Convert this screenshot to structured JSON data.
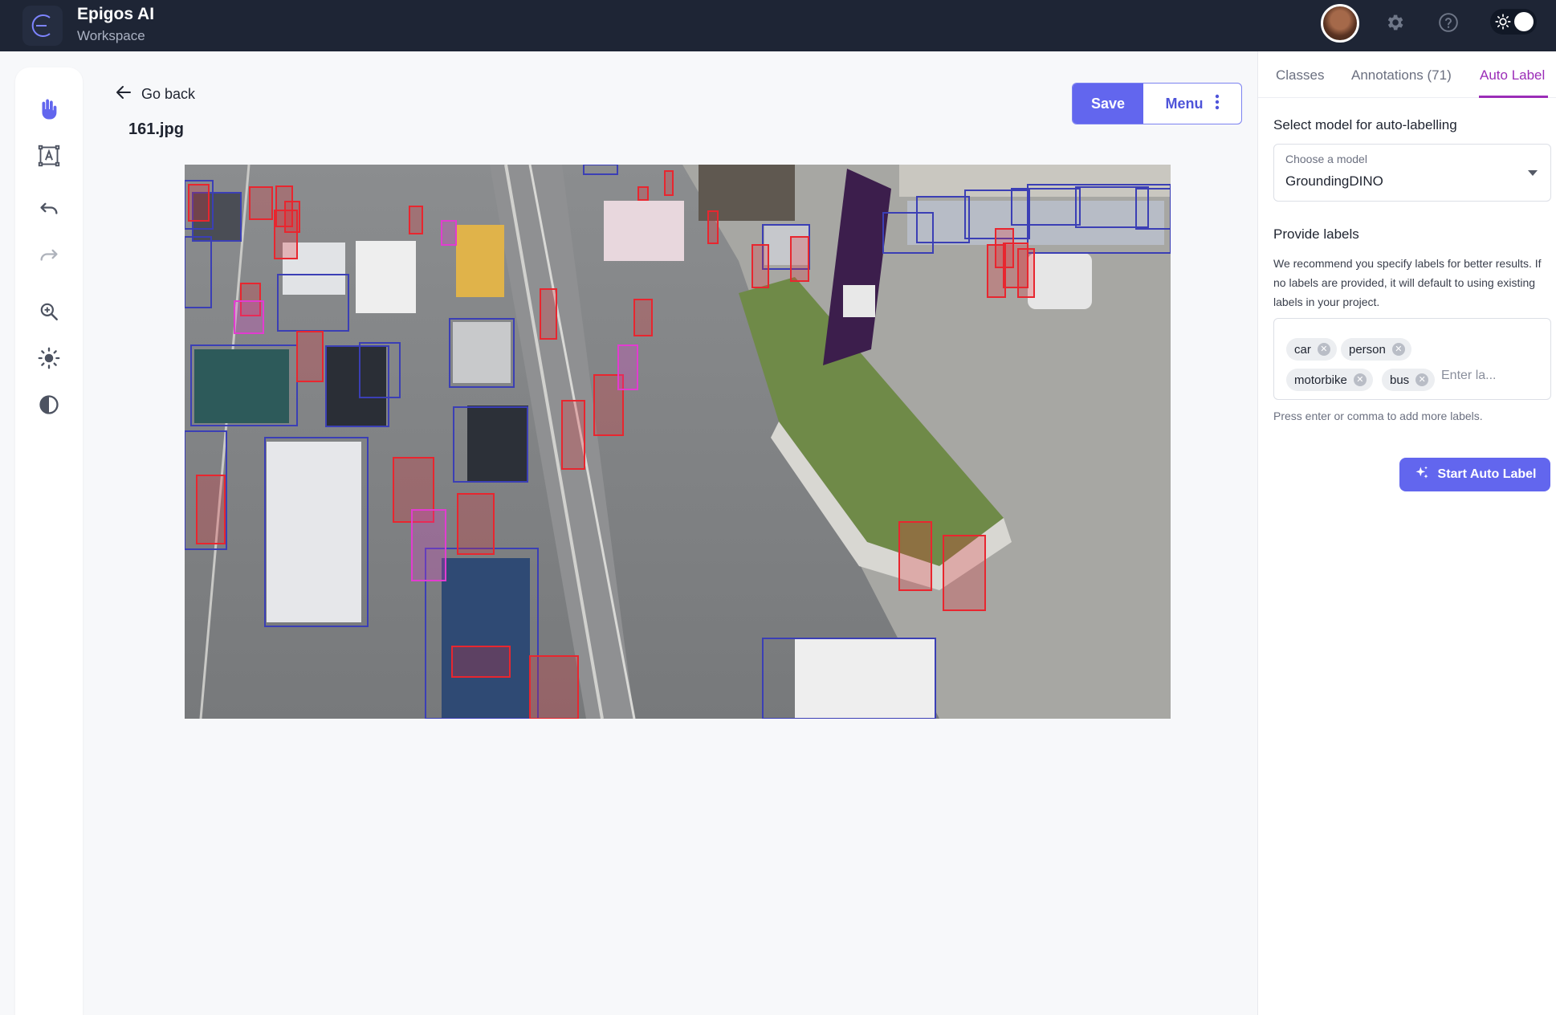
{
  "app": {
    "title": "Epigos AI",
    "subtitle": "Workspace"
  },
  "topbar": {
    "icons": [
      "user-avatar",
      "settings-icon",
      "help-icon",
      "theme-toggle"
    ]
  },
  "toolbar": {
    "tools": [
      "hand-tool-icon",
      "bounding-box-tool-icon",
      "undo-icon",
      "redo-icon",
      "zoom-icon",
      "brightness-icon",
      "contrast-icon"
    ]
  },
  "header": {
    "go_back": "Go back",
    "file_name": "161.jpg",
    "save_label": "Save",
    "menu_label": "Menu"
  },
  "panel": {
    "tabs": [
      {
        "label": "Classes"
      },
      {
        "label": "Annotations (71)"
      },
      {
        "label": "Auto Label"
      }
    ],
    "active_tab": "Auto Label",
    "select_heading": "Select model for auto-labelling",
    "select_label": "Choose a model",
    "select_value": "GroundingDINO",
    "labels_heading": "Provide labels",
    "labels_help": "We recommend you specify labels for better results. If no labels are provided, it will default to using existing labels in your project.",
    "labels": [
      "car",
      "person",
      "motorbike",
      "bus"
    ],
    "label_placeholder": "Enter la...",
    "labels_hint": "Press enter or comma to add more labels.",
    "start_button": "Start Auto Label"
  },
  "colors": {
    "topbar": "#1e2535",
    "accent": "#6266ee",
    "active_tab": "#9b2db8",
    "car_box": "#3b3fb5",
    "person_box": "#e8262f",
    "motorbike_box": "#e23cd0"
  }
}
